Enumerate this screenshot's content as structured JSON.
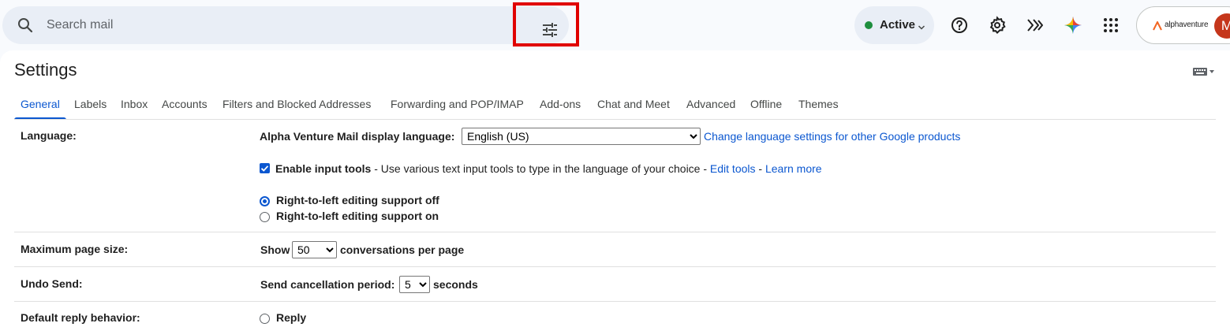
{
  "search": {
    "placeholder": "Search mail"
  },
  "status": {
    "label": "Active",
    "color": "#1e8e3e"
  },
  "account": {
    "brand": "alphaventure",
    "avatar_initial": "M"
  },
  "colors": {
    "accent": "#0b57d0",
    "highlight": "#e00000",
    "avatar": "#c5361b"
  },
  "settings": {
    "title": "Settings",
    "tabs": [
      {
        "label": "General",
        "active": true
      },
      {
        "label": "Labels"
      },
      {
        "label": "Inbox"
      },
      {
        "label": "Accounts"
      },
      {
        "label": "Filters and Blocked Addresses"
      },
      {
        "label": "Forwarding and POP/IMAP"
      },
      {
        "label": "Add-ons"
      },
      {
        "label": "Chat and Meet"
      },
      {
        "label": "Advanced"
      },
      {
        "label": "Offline"
      },
      {
        "label": "Themes"
      }
    ],
    "language": {
      "label": "Language:",
      "display_label": "Alpha Venture Mail display language:",
      "selected": "English (US)",
      "change_link": "Change language settings for other Google products",
      "input_tools_label": "Enable input tools",
      "input_tools_checked": true,
      "input_tools_desc": " - Use various text input tools to type in the language of your choice - ",
      "edit_tools": "Edit tools",
      "sep": " - ",
      "learn_more": "Learn more",
      "rtl_off": "Right-to-left editing support off",
      "rtl_on": "Right-to-left editing support on",
      "rtl_selected": "off"
    },
    "page_size": {
      "label": "Maximum page size:",
      "show": "Show",
      "selected": "50",
      "suffix": "conversations per page"
    },
    "undo_send": {
      "label": "Undo Send:",
      "prefix": "Send cancellation period:",
      "selected": "5",
      "suffix": "seconds"
    },
    "reply": {
      "label": "Default reply behavior:",
      "option": "Reply"
    }
  }
}
